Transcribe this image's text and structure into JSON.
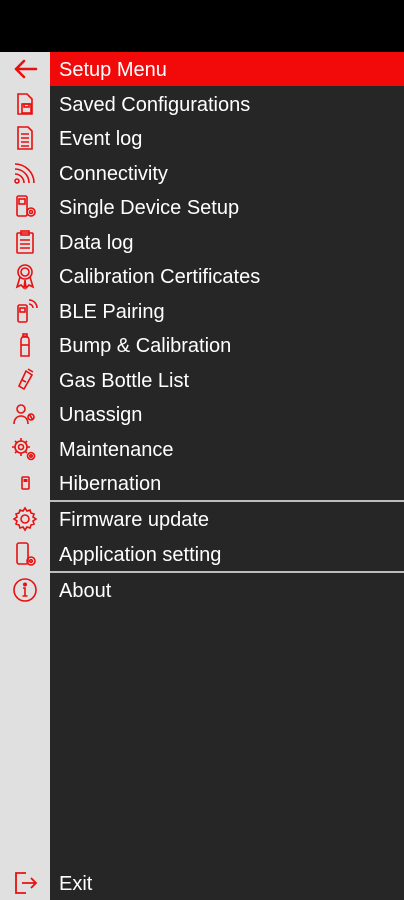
{
  "menu": {
    "header": {
      "title": "Setup Menu",
      "back_icon": "arrow-left-icon"
    },
    "items": [
      {
        "label": "Saved Configurations",
        "icon": "save-device-icon"
      },
      {
        "label": "Event log",
        "icon": "document-list-icon"
      },
      {
        "label": "Connectivity",
        "icon": "wireless-signal-icon"
      },
      {
        "label": "Single Device Setup",
        "icon": "device-settings-icon"
      },
      {
        "label": "Data log",
        "icon": "clipboard-icon"
      },
      {
        "label": "Calibration Certificates",
        "icon": "certificate-ribbon-icon"
      },
      {
        "label": "BLE Pairing",
        "icon": "bluetooth-device-icon"
      },
      {
        "label": "Bump & Calibration",
        "icon": "gas-cylinder-icon"
      },
      {
        "label": "Gas Bottle List",
        "icon": "gas-bottle-icon"
      },
      {
        "label": "Unassign",
        "icon": "user-remove-icon"
      },
      {
        "label": "Maintenance",
        "icon": "gears-icon"
      },
      {
        "label": "Hibernation",
        "icon": "small-device-icon"
      },
      {
        "label": "Firmware update",
        "icon": "gear-icon"
      },
      {
        "label": "Application setting",
        "icon": "phone-settings-icon"
      },
      {
        "label": "About",
        "icon": "info-icon"
      }
    ],
    "exit": {
      "label": "Exit",
      "icon": "exit-door-icon"
    }
  },
  "colors": {
    "accent": "#f20a0a",
    "panel_background": "#262626",
    "icon_rail": "#e0e0e0",
    "divider": "#bdbdbd",
    "text": "#ffffff"
  }
}
